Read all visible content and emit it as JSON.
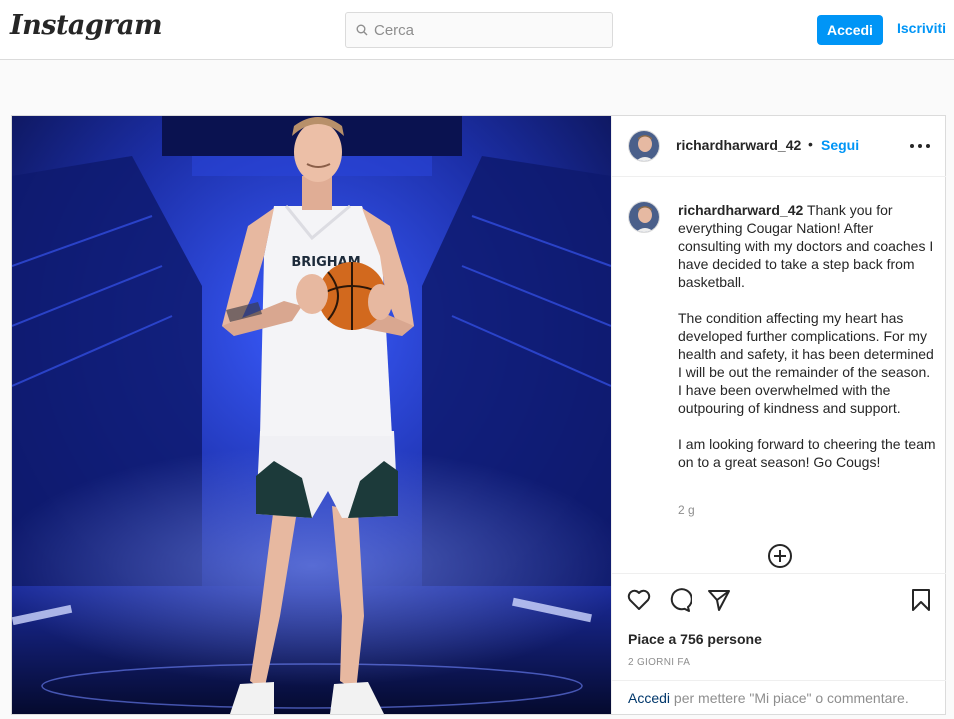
{
  "header": {
    "logo_text": "Instagram",
    "search_placeholder": "Cerca",
    "login_label": "Accedi",
    "signup_label": "Iscriviti"
  },
  "post": {
    "username": "richardharward_42",
    "separator": "•",
    "follow_label": "Segui",
    "caption_paragraphs": [
      "Thank you for everything Cougar Nation! After consulting with my doctors and coaches I have decided to take a step back from basketball.",
      "The condition affecting my heart has developed further complications. For my health and safety, it has been determined I will be out the remainder of the season. I have been overwhelmed with the outpouring of kindness and support.",
      "I am looking forward to cheering the team on to a great season! Go Cougs!"
    ],
    "caption_age": "2 g",
    "likes_text": "Piace a 756 persone",
    "date_text": "2 GIORNI FA",
    "login_link": "Accedi",
    "login_prompt": " per mettere \"Mi piace\" o commentare."
  },
  "photo": {
    "jersey_text": "BRIGHAM",
    "background_color": "#1c2fa8",
    "accent_color": "#0095f6"
  },
  "icons": [
    "search-icon",
    "more-options-icon",
    "load-more-comments-icon",
    "like-heart-icon",
    "comment-icon",
    "share-icon",
    "save-bookmark-icon"
  ]
}
